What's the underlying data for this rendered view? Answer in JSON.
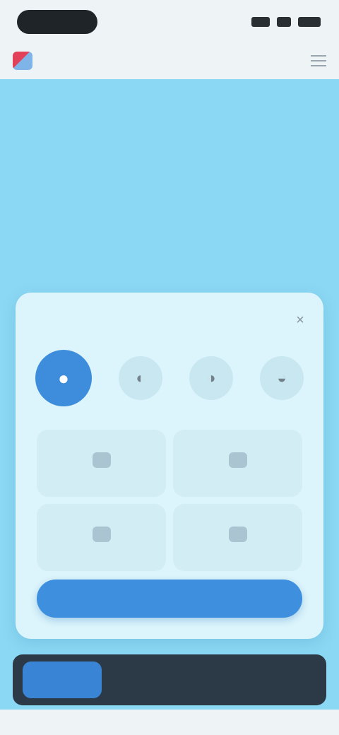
{
  "status_bar": {
    "time": "",
    "icons": [
      "signal-icon",
      "wifi-icon",
      "battery-icon"
    ]
  },
  "nav": {
    "tabs": [
      {
        "label": ""
      },
      {
        "label": ""
      },
      {
        "label": ""
      }
    ],
    "active_tab_index": 1
  },
  "card": {
    "title": "",
    "close_glyph": "×",
    "modes": [
      {
        "icon": "mode-1-icon",
        "active": true
      },
      {
        "icon": "mode-2-icon",
        "active": false
      },
      {
        "icon": "mode-3-icon",
        "active": false
      },
      {
        "icon": "mode-4-icon",
        "active": false
      }
    ],
    "options": [
      {
        "label": ""
      },
      {
        "label": ""
      },
      {
        "label": ""
      },
      {
        "label": ""
      }
    ],
    "primary_button_label": ""
  },
  "banner": {
    "button_label": "",
    "text": ""
  },
  "colors": {
    "background": "#8BD8F4",
    "accent": "#3E8FDE",
    "card": "#DCF4FB",
    "banner": "#2B3A46"
  }
}
